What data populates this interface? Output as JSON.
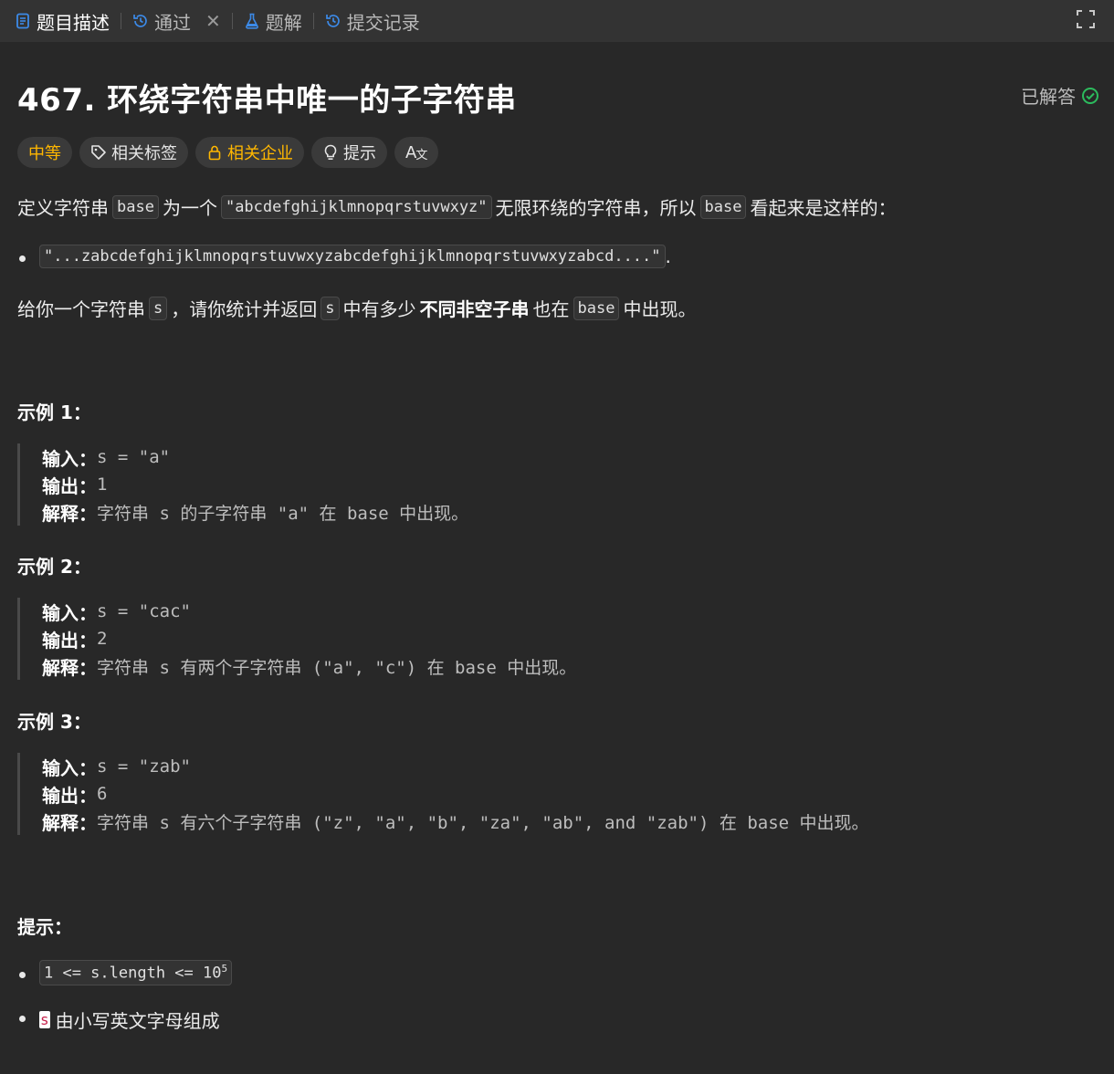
{
  "tabs": [
    {
      "label": "题目描述",
      "icon": "document-icon",
      "active": true
    },
    {
      "label": "通过",
      "icon": "history-icon",
      "active": false
    },
    {
      "label": "题解",
      "icon": "flask-icon",
      "active": false
    },
    {
      "label": "提交记录",
      "icon": "history-icon",
      "active": false
    }
  ],
  "problem": {
    "title": "467. 环绕字符串中唯一的子字符串",
    "status": "已解答",
    "tags": {
      "difficulty": "中等",
      "related_tags": "相关标签",
      "related_companies": "相关企业",
      "hint": "提示",
      "translate": "A"
    }
  },
  "description": {
    "p1_a": "定义字符串",
    "p1_code1": "base",
    "p1_b": "为一个",
    "p1_code2": "\"abcdefghijklmnopqrstuvwxyz\"",
    "p1_c": "无限环绕的字符串，所以",
    "p1_code3": "base",
    "p1_d": "看起来是这样的：",
    "bullet_code": "\"...zabcdefghijklmnopqrstuvwxyzabcdefghijklmnopqrstuvwxyzabcd....\"",
    "bullet_tail": ".",
    "p2_a": "给你一个字符串",
    "p2_code1": "s",
    "p2_b": "，请你统计并返回",
    "p2_code2": "s",
    "p2_c": "中有多少",
    "p2_bold": "不同非空子串",
    "p2_d": "也在",
    "p2_code3": "base",
    "p2_e": "中出现。"
  },
  "examples": [
    {
      "heading": "示例 1：",
      "input_label": "输入：",
      "input": "s = \"a\"",
      "output_label": "输出：",
      "output": "1",
      "explain_label": "解释：",
      "explain": "字符串 s 的子字符串 \"a\" 在 base 中出现。"
    },
    {
      "heading": "示例 2：",
      "input_label": "输入：",
      "input": "s = \"cac\"",
      "output_label": "输出：",
      "output": "2",
      "explain_label": "解释：",
      "explain": "字符串 s 有两个子字符串 (\"a\", \"c\") 在 base 中出现。"
    },
    {
      "heading": "示例 3：",
      "input_label": "输入：",
      "input": "s = \"zab\"",
      "output_label": "输出：",
      "output": "6",
      "explain_label": "解释：",
      "explain": "字符串 s 有六个子字符串 (\"z\", \"a\", \"b\", \"za\", \"ab\", and \"zab\") 在 base 中出现。"
    }
  ],
  "constraints": {
    "heading": "提示：",
    "c1": "1 <= s.length <= 10",
    "c1_sup": "5",
    "c2_code": "s",
    "c2_text": "由小写英文字母组成"
  },
  "colors": {
    "background": "#282828",
    "tabbar": "#333333",
    "difficulty": "#ffb700",
    "solved_check": "#2cbb5d",
    "tab_icon": "#3c8ae8"
  }
}
